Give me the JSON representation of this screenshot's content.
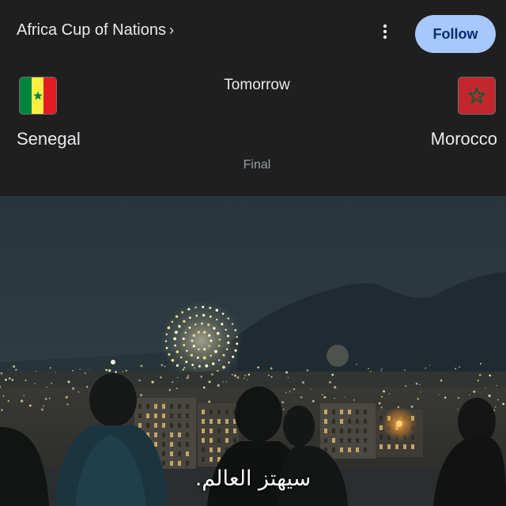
{
  "header": {
    "competition": "Africa Cup of Nations",
    "chevron_icon": "chevron-right-icon",
    "more_icon": "more-vert-icon",
    "follow_label": "Follow"
  },
  "match": {
    "time": "Tomorrow",
    "stage": "Final",
    "home": {
      "name": "Senegal",
      "flag_icon": "senegal-flag-icon",
      "flag_colors": [
        "#00853f",
        "#fdef42",
        "#e31b23"
      ]
    },
    "away": {
      "name": "Morocco",
      "flag_icon": "morocco-flag-icon",
      "flag_colors": [
        "#c1272d",
        "#006233"
      ]
    }
  },
  "video": {
    "scene": "night city skyline with fireworks and silhouetted spectators",
    "subtitle": "سيهتز العالم."
  },
  "colors": {
    "card_background": "#1f1f1f",
    "follow_button": "#a8c7fa",
    "follow_text": "#062e6f",
    "primary_text": "#e8eaed",
    "secondary_text": "#9aa0a6"
  }
}
